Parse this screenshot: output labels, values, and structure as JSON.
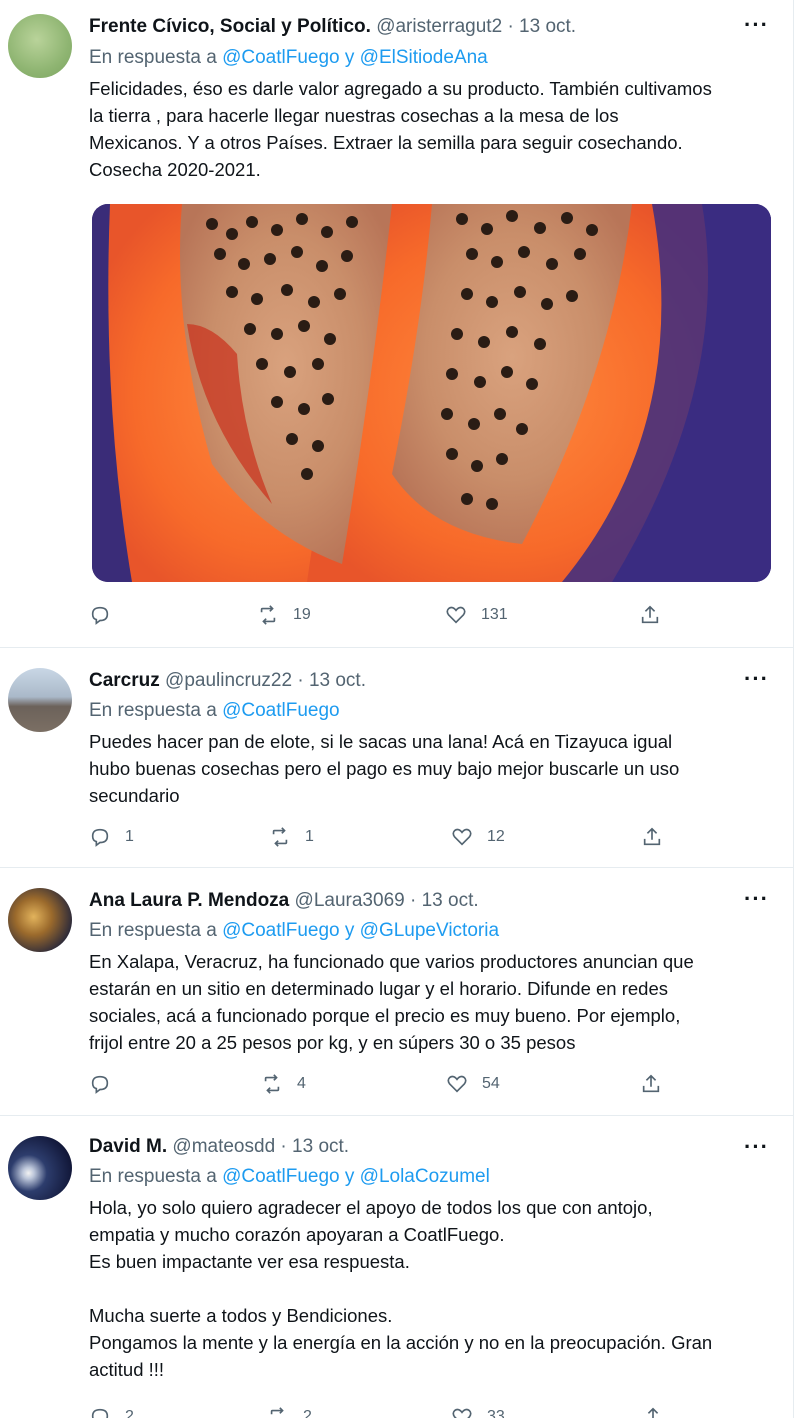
{
  "replying_label": "En respuesta a",
  "tweets": [
    {
      "name": "Frente Cívico, Social y Político.",
      "handle": "@aristerragut2",
      "dot": "·",
      "date": "13 oct.",
      "more": "···",
      "replying_to": "@CoatlFuego y @ElSitiodeAna",
      "text": "Felicidades, éso es darle valor agregado a su producto. También cultivamos\nla tierra , para hacerle llegar nuestras cosechas a la mesa de los\nMexicanos. Y a otros Países. Extraer la semilla para seguir cosechando.\nCosecha 2020-2021.",
      "replies": "",
      "retweets": "19",
      "likes": "131"
    },
    {
      "name": "Carcruz",
      "handle": "@paulincruz22",
      "dot": "·",
      "date": "13 oct.",
      "more": "···",
      "replying_to": "@CoatlFuego",
      "text": "Puedes hacer pan de elote, si le sacas una lana! Acá en Tizayuca igual\nhubo buenas cosechas pero el pago es muy bajo mejor buscarle un uso\nsecundario",
      "replies": "1",
      "retweets": "1",
      "likes": "12"
    },
    {
      "name": "Ana Laura P. Mendoza",
      "handle": "@Laura3069",
      "dot": "·",
      "date": "13 oct.",
      "more": "···",
      "replying_to": "@CoatlFuego y @GLupeVictoria",
      "text": "En Xalapa, Veracruz, ha funcionado que varios productores anuncian que\nestarán en un sitio en determinado lugar y el horario. Difunde en redes\nsociales, acá a funcionado porque el precio es muy bueno. Por ejemplo,\nfrijol entre 20 a 25 pesos por kg, y en súpers 30 o 35 pesos",
      "replies": "",
      "retweets": "4",
      "likes": "54"
    },
    {
      "name": "David M.",
      "handle": "@mateosdd",
      "dot": "·",
      "date": "13 oct.",
      "more": "···",
      "replying_to": "@CoatlFuego y @LolaCozumel",
      "text": "Hola, yo solo quiero agradecer el apoyo de todos los que con antojo,\nempatia y mucho corazón apoyaran a CoatlFuego.\nEs buen impactante ver esa respuesta.\n\nMucha suerte a todos y Bendiciones.\nPongamos la mente y la energía en la acción y no en la preocupación. Gran\nactitud !!!",
      "replies": "2",
      "retweets": "2",
      "likes": "33"
    }
  ],
  "icons": {
    "reply": "reply-icon",
    "retweet": "retweet-icon",
    "like": "heart-icon",
    "share": "share-icon"
  },
  "colors": {
    "link": "#1d9bf0",
    "secondary_text": "#536471",
    "primary_text": "#0f1419"
  }
}
